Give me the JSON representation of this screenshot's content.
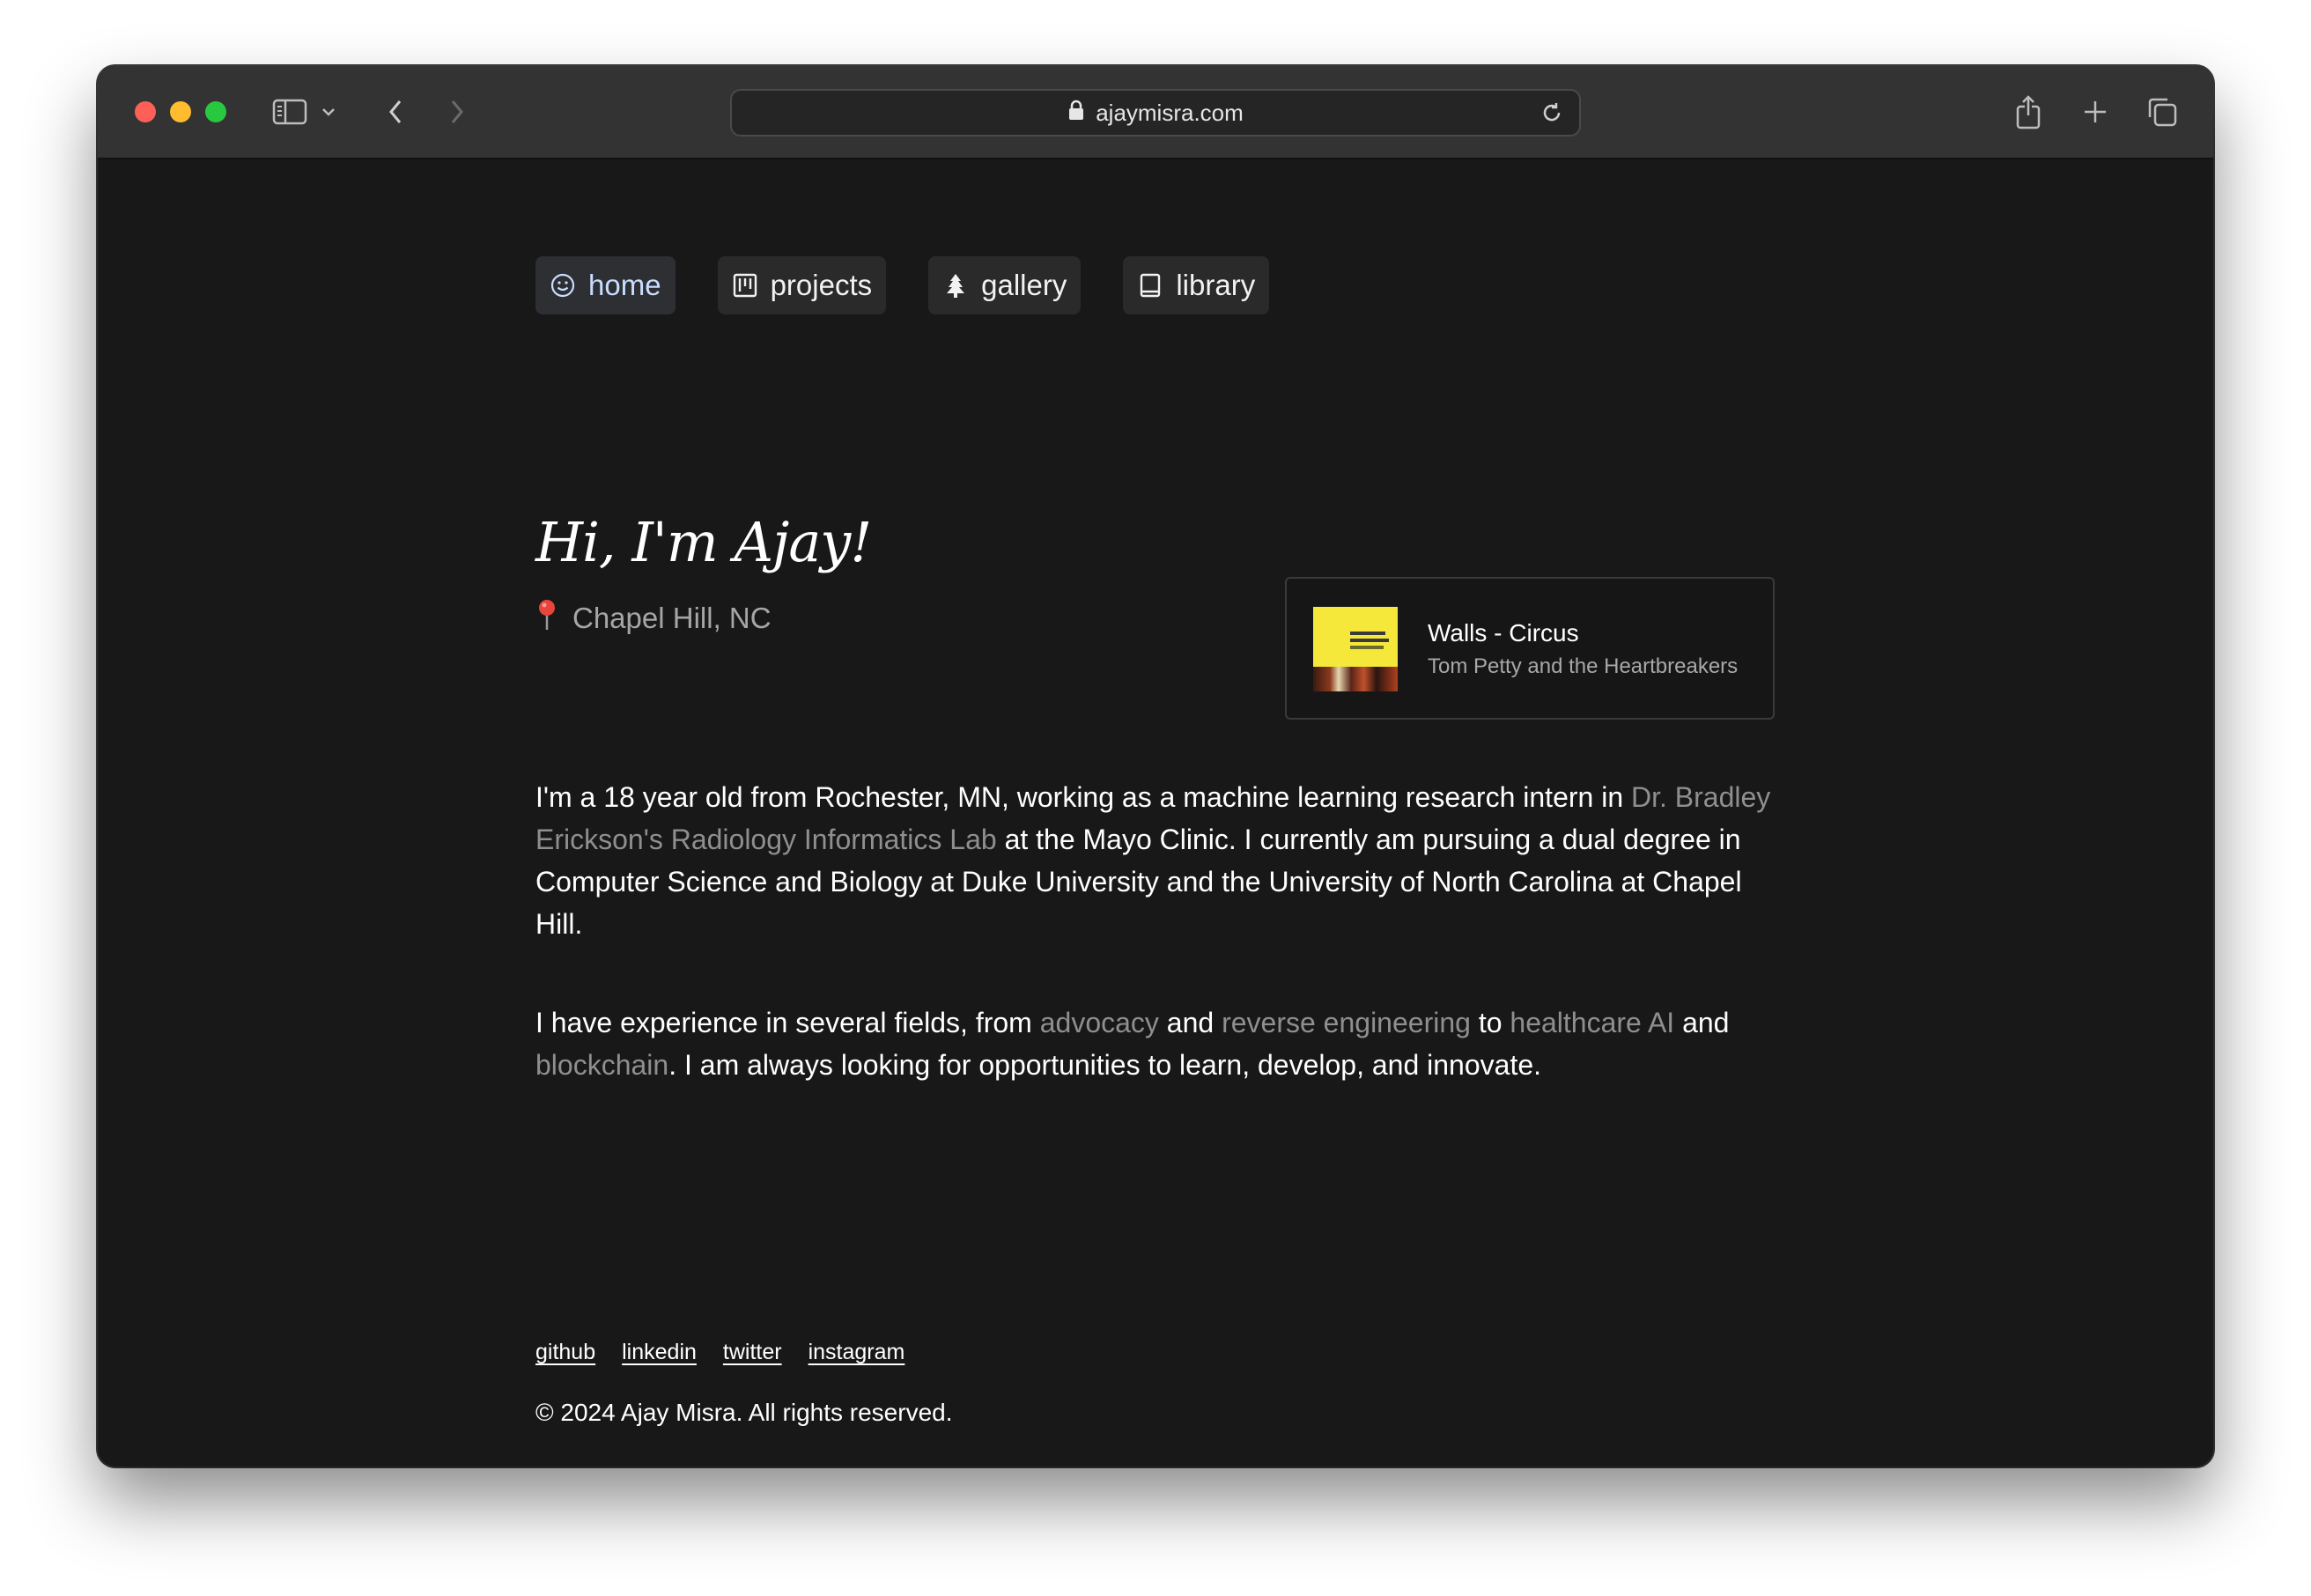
{
  "browser": {
    "url": "ajaymisra.com"
  },
  "nav": [
    {
      "label": "home",
      "icon": "smiley-icon"
    },
    {
      "label": "projects",
      "icon": "kanban-icon"
    },
    {
      "label": "gallery",
      "icon": "tree-icon"
    },
    {
      "label": "library",
      "icon": "book-icon"
    }
  ],
  "hero": {
    "title": "Hi, I'm Ajay!",
    "location": "Chapel Hill, NC",
    "location_icon": "pin-icon"
  },
  "now_playing": {
    "title": "Walls - Circus",
    "artist": "Tom Petty and the Heartbreakers"
  },
  "about": {
    "p1": {
      "t1": "I'm a 18 year old from Rochester, MN, working as a machine learning research intern in ",
      "link1": "Dr. Bradley Erickson's Radiology Informatics Lab",
      "t2": " at the Mayo Clinic. I currently am pursuing a dual degree in Computer Science and Biology at Duke University and the University of North Carolina at Chapel Hill."
    },
    "p2": {
      "t1": "I have experience in several fields, from ",
      "link1": "advocacy",
      "t2": " and ",
      "link2": "reverse engineering",
      "t3": " to ",
      "link3": "healthcare AI",
      "t4": " and ",
      "link4": "blockchain",
      "t5": ". I am always looking for opportunities to learn, develop, and innovate."
    }
  },
  "footer": {
    "links": [
      "github",
      "linkedin",
      "twitter",
      "instagram"
    ],
    "copyright": "© 2024 Ajay Misra. All rights reserved."
  },
  "colors": {
    "background": "#181818",
    "link_gray": "#8f8f8f",
    "active_nav": "#c9ddff"
  }
}
